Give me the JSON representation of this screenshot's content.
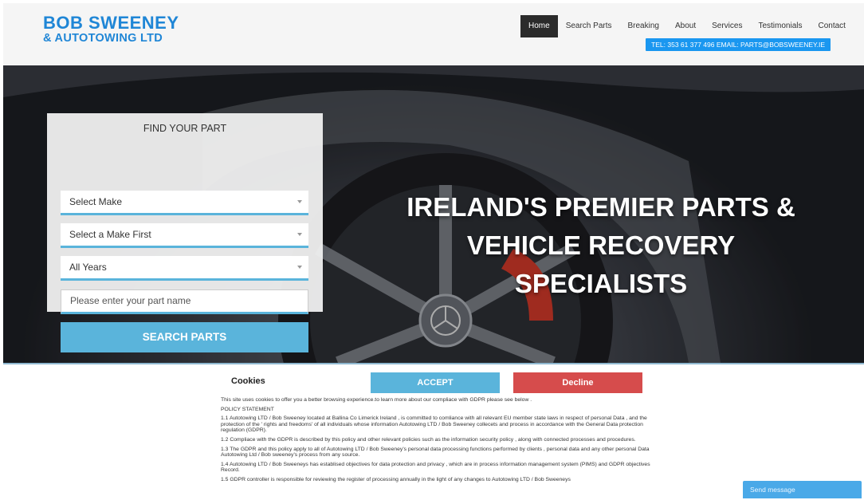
{
  "logo": {
    "line1": "BOB SWEENEY",
    "line2": "& AUTOTOWING LTD"
  },
  "nav": {
    "items": [
      {
        "label": "Home"
      },
      {
        "label": "Search Parts"
      },
      {
        "label": "Breaking"
      },
      {
        "label": "About"
      },
      {
        "label": "Services"
      },
      {
        "label": "Testimonials"
      },
      {
        "label": "Contact"
      }
    ],
    "active_index": 0
  },
  "contact_bar": "TEL: 353 61 377 496 EMAIL: PARTS@BOBSWEENEY.IE",
  "hero": {
    "title_line1": "IRELAND'S PREMIER PARTS &",
    "title_line2": "VEHICLE RECOVERY SPECIALISTS"
  },
  "finder": {
    "title": "FIND YOUR PART",
    "make_select": "Select Make",
    "model_select": "Select a Make First",
    "year_select": "All Years",
    "part_placeholder": "Please enter your part name",
    "search_button": "SEARCH PARTS"
  },
  "cookie": {
    "heading": "Cookies",
    "accept": "ACCEPT",
    "decline": "Decline",
    "paragraphs": [
      "This site uses cookies to offer you a better browsing experience.to learn more about our compliace with GDPR please see below .",
      "POLICY STATEMENT",
      "1.1 Autotowing LTD / Bob Sweeney located at Ballina Co Limerick Ireland , is committed to comliance with all relevant EU member state laws in respect of personal Data , and the protection of the ' rights and freedoms' of all individuals whose information Autotowing LTD / Bob Sweeney collecets and process in accordance with the General Data protection regulation (GDPR).",
      "1.2 Compliace with the GDPR is described by this policy and other relevant policies such as the information security policy , along with connected processes and procedures.",
      "1.3 The GDPR and this policy apply to all of Autotowing LTD / Bob Sweeney's personal data processing functions performed by clients , personal data and any other personal Data Autotowing Ltd / Bob sweeney's process from any source.",
      "1.4 Autotowing LTD / Bob Sweeneys has establised objectives for data protection and privacy , which are in process information management system (PIMS) and GDPR objectives Record.",
      "1.5 GDPR controller is responsible for reviewing the register of processing annually in the light of any changes to Autotowing LTD / Bob Sweeneys"
    ]
  },
  "chat": {
    "label": "Send message"
  }
}
